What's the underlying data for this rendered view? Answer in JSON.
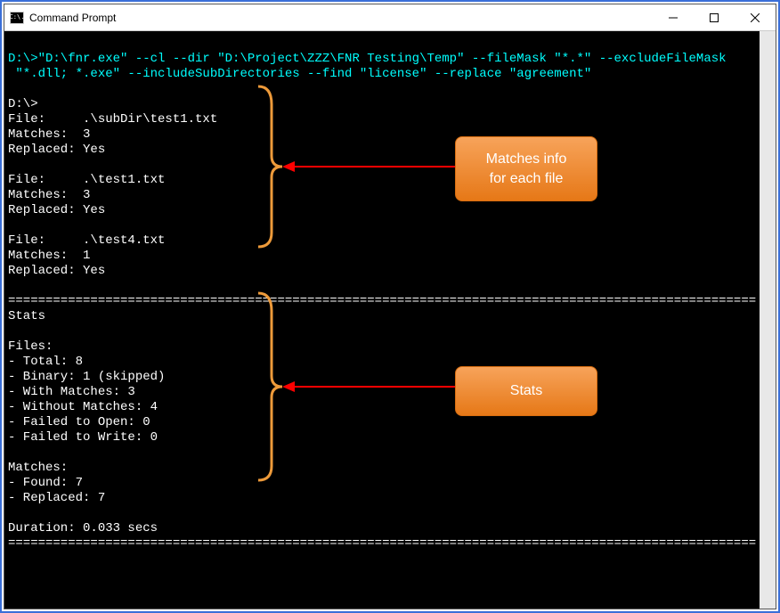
{
  "window": {
    "title": "Command Prompt",
    "icon_text": "C:\\."
  },
  "console": {
    "command_line1": "D:\\>\"D:\\fnr.exe\" --cl --dir \"D:\\Project\\ZZZ\\FNR Testing\\Temp\" --fileMask \"*.*\" --excludeFileMask",
    "command_line2": " \"*.dll; *.exe\" --includeSubDirectories --find \"license\" --replace \"agreement\"",
    "prompt": "D:\\>",
    "files": [
      {
        "file": "File:     .\\subDir\\test1.txt",
        "matches": "Matches:  3",
        "replaced": "Replaced: Yes"
      },
      {
        "file": "File:     .\\test1.txt",
        "matches": "Matches:  3",
        "replaced": "Replaced: Yes"
      },
      {
        "file": "File:     .\\test4.txt",
        "matches": "Matches:  1",
        "replaced": "Replaced: Yes"
      }
    ],
    "divider": "====================================================================================================",
    "stats_header": "Stats",
    "files_header": "Files:",
    "files_stats": [
      "- Total: 8",
      "- Binary: 1 (skipped)",
      "- With Matches: 3",
      "- Without Matches: 4",
      "- Failed to Open: 0",
      "- Failed to Write: 0"
    ],
    "matches_header": "Matches:",
    "matches_stats": [
      "- Found: 7",
      "- Replaced: 7"
    ],
    "duration": "Duration: 0.033 secs"
  },
  "annotations": {
    "callout1_l1": "Matches info",
    "callout1_l2": "for each file",
    "callout2": "Stats"
  },
  "colors": {
    "brace": "#ed9a3a",
    "arrow": "#ff0000",
    "cyan": "#00ffff"
  }
}
